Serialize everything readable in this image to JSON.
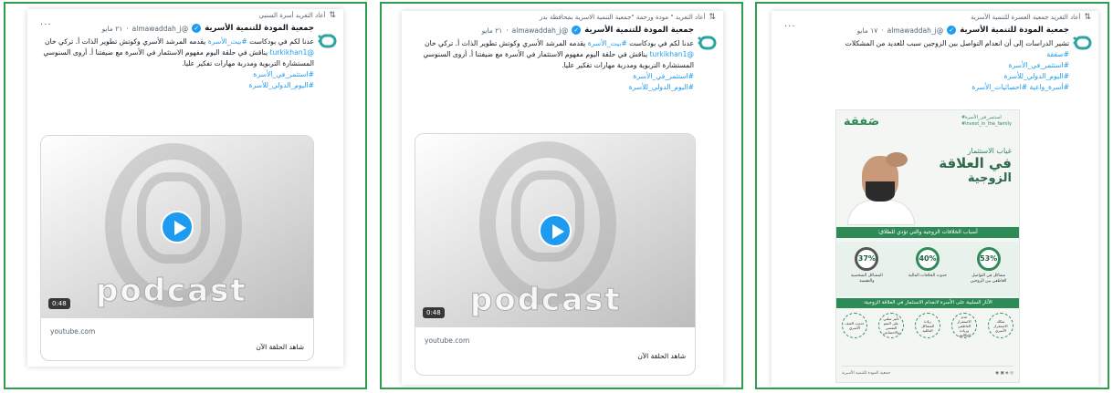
{
  "colors": {
    "panel_border": "#2e9d4e",
    "link": "#1d9bf0",
    "verified": "#1d9bf0",
    "brand_green": "#2e8b57"
  },
  "icons": {
    "retweet": "retweet-icon",
    "verified": "verified-badge-icon",
    "more": "more-icon",
    "play": "play-icon",
    "logo": "mawadda-logo-icon"
  },
  "panels": [
    {
      "retweet_label": "أعاد التغريد أسرة السنبي",
      "author_name": "جمعية المودة للتنمية الأسرية",
      "handle": "@almawaddah_j",
      "date": "٢١ مايو",
      "more_label": "···",
      "text_parts": {
        "p1_a": "عدنا لكم في بودكاست ",
        "p1_link": "#بيت_الأسرة",
        "p1_b": " يقدمه المرشد الأسري وكوتش تطوير الذات أ. تركي خان ",
        "p1_mention": "@turkikhan1",
        "p1_c": " يناقش في حلقة اليوم مفهوم الاستثمار في الأسرة مع ضيفتنا أ. أروى السنوسي المستشارة التربوية ومدربة مهارات تفكير عليا."
      },
      "hashtags": [
        "#استثمر_في_الأسرة",
        "#اليوم_الدولي_للأسرة"
      ],
      "media": {
        "duration": "0:48",
        "watermark": "podcast",
        "domain": "youtube.com",
        "title": "شاهد الحلقة الآن"
      }
    },
    {
      "retweet_label": "أعاد التغريد \" مودة ورحمة \"جمعية التنمية الاسرية بمحافظة بدر",
      "author_name": "جمعية المودة للتنمية الأسرية",
      "handle": "@almawaddah_j",
      "date": "٢١ مايو",
      "more_label": "",
      "text_parts": {
        "p1_a": "عدنا لكم في بودكاست ",
        "p1_link": "#بيت_الأسرة",
        "p1_b": " يقدمه المرشد الأسري وكوتش تطوير الذات أ. تركي خان ",
        "p1_mention": "@turkikhan1",
        "p1_c": " يناقش في حلقة اليوم مفهوم الاستثمار في الأسرة مع ضيفتنا أ. أروى السنوسي المستشارة التربوية ومدربة مهارات تفكير عليا."
      },
      "hashtags": [
        "#استثمر_في_الأسرة",
        "#اليوم_الدولي_للأسرة"
      ],
      "media": {
        "duration": "0:48",
        "watermark": "podcast",
        "domain": "youtube.com",
        "title": "شاهد الحلقة الآن"
      }
    },
    {
      "retweet_label": "أعاد التغريد جمعية العسرة للتنمية الأسرية",
      "author_name": "جمعية المودة للتنمية الأسرية",
      "handle": "@almawaddah_j",
      "date": "١٧ مايو",
      "more_label": "···",
      "text": "تشير الدراسات إلى أن انعدام التواصل بين الزوجين سبب للعديد من المشكلات",
      "hashtags": [
        "#صفقة",
        "#استثمر_في_الأسرة",
        "#اليوم_الدولي_للأسرة",
        "#أسرة_واعية #احصائيات_الأسرة"
      ],
      "infographic": {
        "brand": "صَفقة",
        "tag_ar": "#استثمر_في_الأسرة",
        "tag_en": "#invest_in_the_family",
        "title_1": "غياب الاستثمار",
        "title_2": "في العلاقة",
        "title_3": "الزوجية",
        "band_1": "أسباب الخلافات الزوجية والتي تؤدي للطلاق:",
        "stats": [
          {
            "value": "53%",
            "caption": "مشاكل في التواصل العاطفي بين الزوجين"
          },
          {
            "value": "40%",
            "caption": "حدوث الخلافات المالية"
          },
          {
            "value": "37%",
            "caption": "المشاكل الشخصية والنفسية"
          }
        ],
        "band_2": "الآثار السلبية على الأسرة لانعدام الاستثمار في العلاقة الزوجية:",
        "effects": [
          "تفكك الاستقرار الأسري",
          "عدم الاستقرار العاطفي وزيادة التكاليف",
          "زيادة المشاكل العائلية",
          "تأثير سلبي على النمو النفسي والاجتماعي",
          "حدوث العنف الأسري"
        ],
        "footer": "جمعية المودة للتنمية الأسرية"
      }
    }
  ]
}
